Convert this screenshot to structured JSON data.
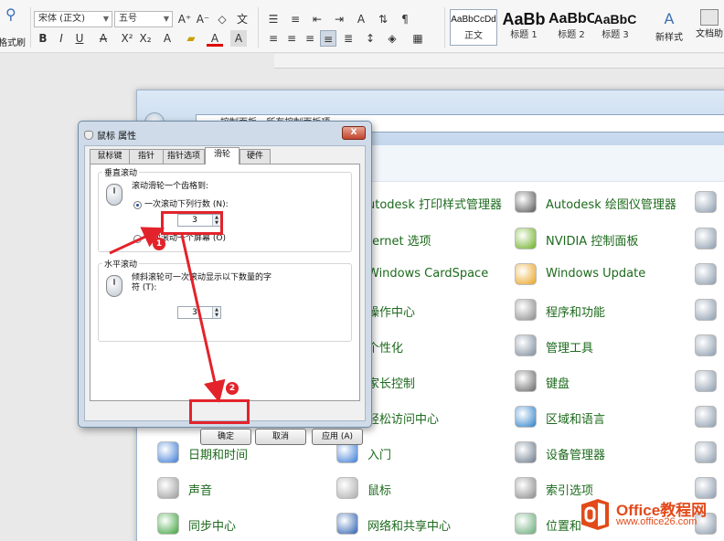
{
  "ribbon": {
    "format_painter_label": "格式刷",
    "font_name": "宋体 (正文)",
    "font_size": "五号",
    "styles": [
      {
        "sample": "AaBbCcDd",
        "label": "正文"
      },
      {
        "sample": "AaBb",
        "label": "标题 1"
      },
      {
        "sample": "AaBbC",
        "label": "标题 2"
      },
      {
        "sample": "AaBbC",
        "label": "标题 3"
      }
    ],
    "new_style_label": "新样式",
    "text_tools_label": "文档助"
  },
  "control_panel": {
    "breadcrumb": "控制面板 › 所有控制面板项 ›",
    "items_col1": [
      {
        "label": "日期和时间",
        "icon": "calendar-clock-icon"
      },
      {
        "label": "声音",
        "icon": "speaker-icon"
      },
      {
        "label": "同步中心",
        "icon": "sync-icon"
      }
    ],
    "items_col2_partial": [
      {
        "label": "utodesk 打印样式管理器",
        "icon": "printer-style-icon"
      },
      {
        "label": "ternet 选项",
        "icon": "internet-options-icon"
      },
      {
        "label": "Windows CardSpace",
        "icon": "cardspace-icon"
      },
      {
        "label": "操作中心",
        "icon": "flag-icon"
      },
      {
        "label": "个性化",
        "icon": "personalization-icon"
      },
      {
        "label": "家长控制",
        "icon": "parental-icon"
      },
      {
        "label": "轻松访问中心",
        "icon": "ease-access-icon"
      }
    ],
    "items_col2_full": [
      {
        "label": "入门",
        "icon": "getting-started-icon"
      },
      {
        "label": "鼠标",
        "icon": "mouse-icon"
      },
      {
        "label": "网络和共享中心",
        "icon": "network-icon"
      }
    ],
    "items_col3": [
      {
        "label": "Autodesk 绘图仪管理器",
        "icon": "plotter-icon"
      },
      {
        "label": "NVIDIA 控制面板",
        "icon": "nvidia-icon"
      },
      {
        "label": "Windows Update",
        "icon": "windows-update-icon"
      },
      {
        "label": "程序和功能",
        "icon": "programs-icon"
      },
      {
        "label": "管理工具",
        "icon": "admin-tools-icon"
      },
      {
        "label": "键盘",
        "icon": "keyboard-icon"
      },
      {
        "label": "区域和语言",
        "icon": "globe-icon"
      },
      {
        "label": "设备管理器",
        "icon": "device-manager-icon"
      },
      {
        "label": "索引选项",
        "icon": "index-icon"
      },
      {
        "label": "位置和",
        "icon": "location-icon"
      }
    ]
  },
  "dialog": {
    "title": "鼠标 属性",
    "close": "X",
    "tabs": [
      "鼠标键",
      "指针",
      "指针选项",
      "滑轮",
      "硬件"
    ],
    "active_tab": "滑轮",
    "vertical": {
      "title": "垂直滚动",
      "desc": "滚动滑轮一个齿格到:",
      "option1": "一次滚动下列行数 (N):",
      "lines": "3",
      "option2": "一次滚动一个屏幕 (O)"
    },
    "horizontal": {
      "title": "水平滚动",
      "desc_line1": "倾斜滚轮可一次滚动显示以下数量的字",
      "desc_line2": "符 (T):",
      "chars": "3"
    },
    "buttons": {
      "ok": "确定",
      "cancel": "取消",
      "apply": "应用 (A)"
    }
  },
  "annotations": {
    "badge1": "1",
    "badge2": "2",
    "color": "#e3232b"
  },
  "watermark": {
    "line1": "Office教程网",
    "line2": "www.office26.com"
  }
}
